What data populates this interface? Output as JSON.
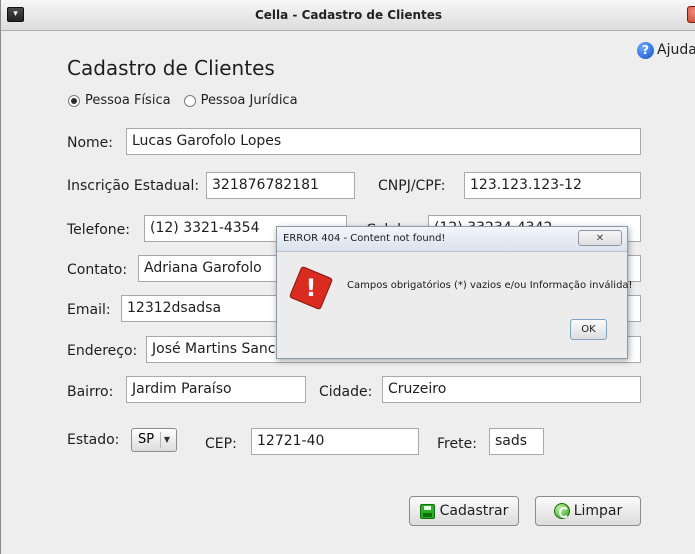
{
  "window": {
    "title": "Cella - Cadastro de Clientes"
  },
  "help": {
    "label": "Ajuda"
  },
  "form": {
    "heading": "Cadastro de Clientes",
    "person_type": {
      "fisica": "Pessoa Física",
      "juridica": "Pessoa Jurídica",
      "selected": "Pessoa Física"
    },
    "nome": {
      "label": "Nome:",
      "value": "Lucas Garofolo Lopes"
    },
    "inscricao": {
      "label": "Inscrição Estadual:",
      "value": "321876782181"
    },
    "cnpj": {
      "label": "CNPJ/CPF:",
      "value": "123.123.123-12"
    },
    "telefone": {
      "label": "Telefone:",
      "value": "(12) 3321-4354"
    },
    "celular": {
      "label": "Celular:",
      "value": "(12) 33234-4342"
    },
    "contato": {
      "label": "Contato:",
      "value": "Adriana Garofolo"
    },
    "email": {
      "label": "Email:",
      "value": "12312dsadsa"
    },
    "endereco": {
      "label": "Endereço:",
      "value": "José Martins Sanches"
    },
    "bairro": {
      "label": "Bairro:",
      "value": "Jardim Paraíso"
    },
    "cidade": {
      "label": "Cidade:",
      "value": "Cruzeiro"
    },
    "estado": {
      "label": "Estado:",
      "value": "SP"
    },
    "cep": {
      "label": "CEP:",
      "value": "12721-40"
    },
    "frete": {
      "label": "Frete:",
      "value": "sads"
    }
  },
  "buttons": {
    "cadastrar": "Cadastrar",
    "limpar": "Limpar"
  },
  "dialog": {
    "title": "ERROR 404 - Content not found!",
    "message": "Campos obrigatórios (*) vazios e/ou Informação inválida!",
    "ok": "OK",
    "close_glyph": "✕"
  },
  "colors": {
    "error_red": "#d92b20",
    "save_green": "#27b324",
    "help_blue": "#1552c9"
  }
}
